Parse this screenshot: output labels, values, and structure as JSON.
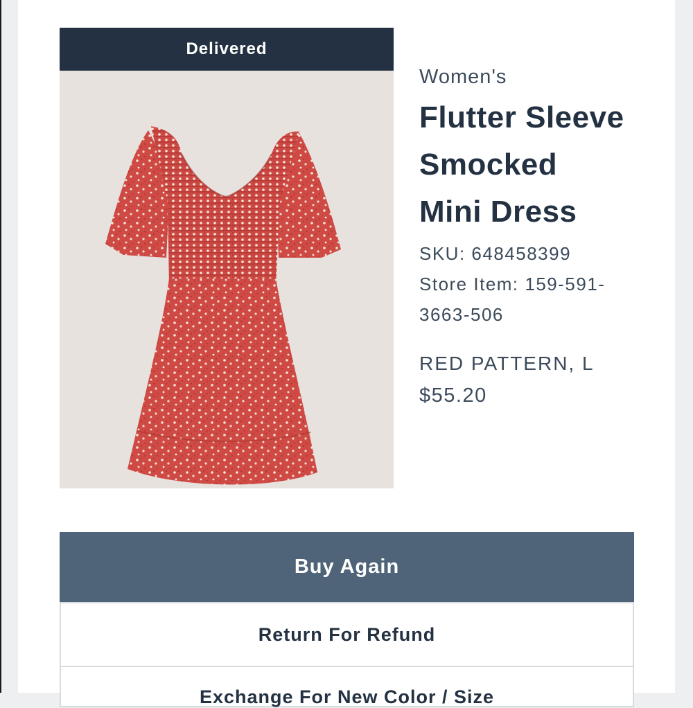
{
  "order_item": {
    "status": "Delivered",
    "category": "Women's",
    "title_lines": [
      "Flutter Sleeve",
      "Smocked",
      "Mini Dress"
    ],
    "sku": "SKU: 648458399",
    "store_item_lines": [
      "Store Item: 159-591-",
      "3663-506"
    ],
    "variant": "RED PATTERN, L",
    "price": "$55.20",
    "image_icon": "red-floral-dress-photo"
  },
  "actions": {
    "buy_again": "Buy Again",
    "return_for_refund": "Return For Refund",
    "exchange": "Exchange For New Color / Size"
  },
  "colors": {
    "banner": "#233142",
    "primary_button": "#4f6478",
    "dress": "#cf4a45",
    "text": "#233142"
  }
}
